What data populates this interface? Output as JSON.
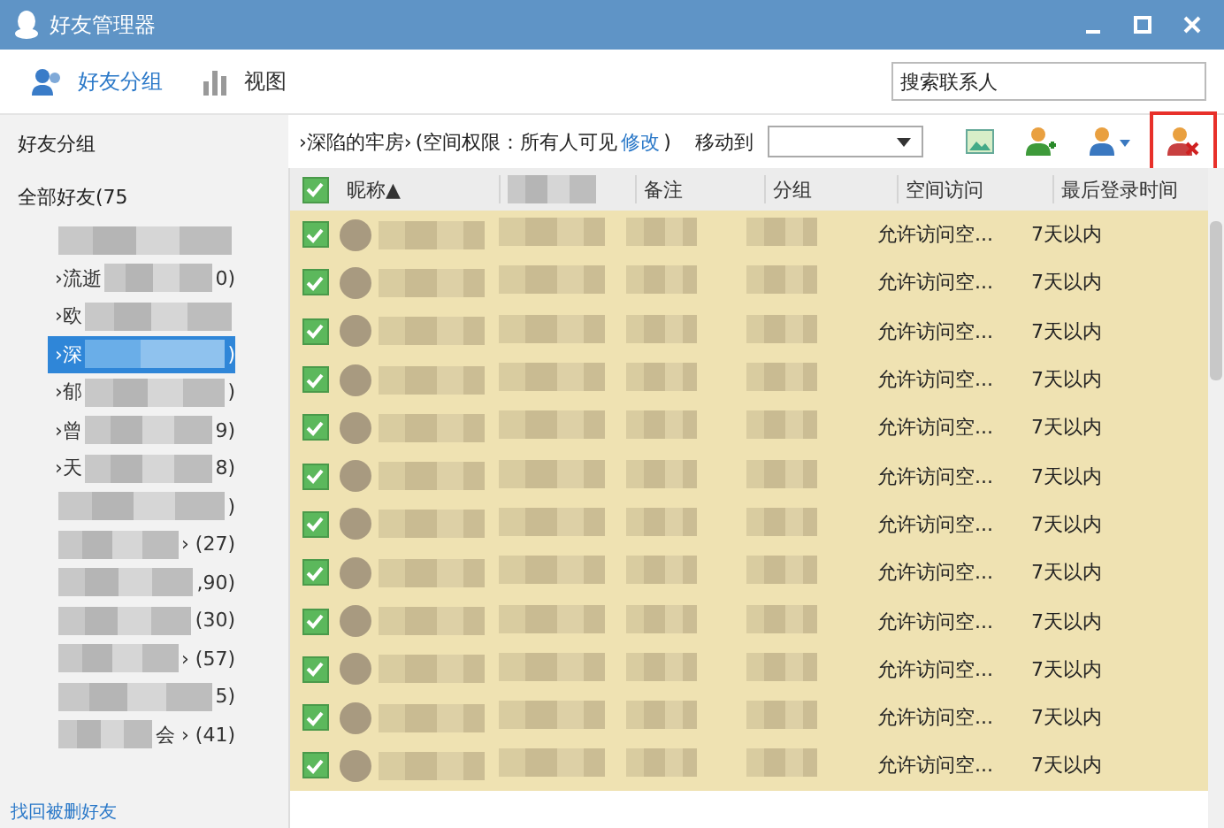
{
  "window": {
    "title": "好友管理器"
  },
  "tabs": [
    {
      "label": "好友分组",
      "selected": true,
      "kind": "people"
    },
    {
      "label": "视图",
      "selected": false,
      "kind": "chart"
    }
  ],
  "search": {
    "placeholder": "搜索联系人"
  },
  "sidebar": {
    "title": "好友分组",
    "all": "全部好友(75",
    "items": [
      {
        "selected": false
      },
      {
        "label": "›流逝",
        "count": "0)",
        "selected": false
      },
      {
        "label": "›欧",
        "selected": false
      },
      {
        "label": "›深",
        "count": ")",
        "selected": true
      },
      {
        "label": "›郁",
        "count": ")",
        "selected": false
      },
      {
        "label": "›曾",
        "count": "9)",
        "selected": false
      },
      {
        "label": "›天",
        "count": "8)",
        "selected": false
      },
      {
        "count": ")",
        "selected": false
      },
      {
        "count": "› (27)",
        "selected": false
      },
      {
        "count": ",90)",
        "selected": false
      },
      {
        "count": "(30)",
        "selected": false
      },
      {
        "count": "› (57)",
        "selected": false
      },
      {
        "count": "5)",
        "selected": false
      },
      {
        "count": "会 › (41)",
        "selected": false
      }
    ],
    "link": "找回被删好友"
  },
  "breadcrumb": {
    "group": "›深陷的牢房›",
    "permission": "(空间权限：所有人可见",
    "link": "修改",
    "close": ")"
  },
  "move_to": {
    "label": "移动到"
  },
  "table": {
    "all_checked": true,
    "columns": [
      "昵称",
      null,
      "备注",
      "分组",
      "空间访问",
      "最后登录时间"
    ],
    "sort_mark": "▲",
    "rows": [
      {
        "checked": true,
        "space": "允许访问空...",
        "last": "7天以内"
      },
      {
        "checked": true,
        "space": "允许访问空...",
        "last": "7天以内"
      },
      {
        "checked": true,
        "space": "允许访问空...",
        "last": "7天以内"
      },
      {
        "checked": true,
        "space": "允许访问空...",
        "last": "7天以内"
      },
      {
        "checked": true,
        "space": "允许访问空...",
        "last": "7天以内"
      },
      {
        "checked": true,
        "space": "允许访问空...",
        "last": "7天以内"
      },
      {
        "checked": true,
        "space": "允许访问空...",
        "last": "7天以内"
      },
      {
        "checked": true,
        "space": "允许访问空...",
        "last": "7天以内"
      },
      {
        "checked": true,
        "space": "允许访问空...",
        "last": "7天以内"
      },
      {
        "checked": true,
        "space": "允许访问空...",
        "last": "7天以内"
      },
      {
        "checked": true,
        "space": "允许访问空...",
        "last": "7天以内"
      },
      {
        "checked": true,
        "space": "允许访问空...",
        "last": "7天以内"
      }
    ]
  }
}
